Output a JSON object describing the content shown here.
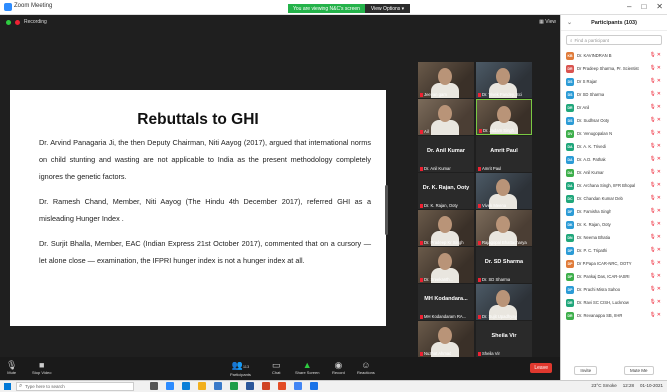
{
  "window": {
    "title": "Zoom Meeting"
  },
  "share_bar": {
    "sharing_label": "You are viewing N&C's screen",
    "view_options": "View Options ▾"
  },
  "meeting": {
    "recording_label": "Recording",
    "view_label": "View"
  },
  "slide": {
    "title": "Rebuttals to GHI",
    "p1": "Dr. Arvind Panagaria Ji, the then Deputy Chairman, Niti Aayog (2017), argued that international norms on child stunting and wasting are not applicable to India as the present methodology completely ignores the genetic factors.",
    "p2": "Dr. Ramesh Chand, Member, Niti Aayog (The Hindu 4th December 2017), referred GHI as a misleading Hunger Index .",
    "p3": "Dr. Surjit Bhalla, Member, EAC (Indian Express 21st October 2017), commented that on a cursory — let alone close — examination, the IFPRI hunger index is not a hunger index at all."
  },
  "video_tiles": [
    {
      "caption": "Jeevan gam",
      "kind": "photo"
    },
    {
      "caption": "Dr. Vivek Pandey, Sci",
      "kind": "photo2"
    },
    {
      "caption": "Ail",
      "kind": "photo3"
    },
    {
      "caption": "Dr. Jadam Singh",
      "kind": "photo",
      "active": true
    },
    {
      "caption": "Dr. Anil Kumar",
      "name_big": "Dr. Anil Kumar",
      "kind": "name"
    },
    {
      "caption": "Amrit Paul",
      "name_big": "Amrit Paul",
      "kind": "name"
    },
    {
      "caption": "Dr. K. Rajan, Ooty",
      "name_big": "Dr. K. Rajan, Ooty",
      "kind": "name"
    },
    {
      "caption": "Vivek Meena",
      "kind": "photo2"
    },
    {
      "caption": "Dr. Pradeep Kr Singh",
      "kind": "photo"
    },
    {
      "caption": "Rajagopal Bhattacharya",
      "kind": "photo3"
    },
    {
      "caption": "Dr. Sreekanth...",
      "kind": "photo"
    },
    {
      "caption": "Dr. SD Sharma",
      "name_big": "Dr. SD Sharma",
      "kind": "name"
    },
    {
      "caption": "MH Kodandaram RA...",
      "name_big": "MH Kodandara...",
      "kind": "name"
    },
    {
      "caption": "Dr. Sujit Upadhyay",
      "kind": "photo2"
    },
    {
      "caption": "Nuzhat Ahmad",
      "kind": "photo"
    },
    {
      "caption": "Sheila Vir",
      "name_big": "Sheila Vir",
      "kind": "name"
    }
  ],
  "toolbar": {
    "mute": "Mute",
    "stop_video": "Stop Video",
    "participants": "Participants",
    "participants_count": "113",
    "chat": "Chat",
    "share_screen": "Share Screen",
    "record": "Record",
    "reactions": "Reactions",
    "leave": "Leave"
  },
  "panel": {
    "title": "Participants (103)",
    "search_placeholder": "Find a participant",
    "invite": "Invite",
    "mute_me": "Mute Me",
    "participants": [
      {
        "initials": "KB",
        "name": "Dr. KAVINDRAN B",
        "color": "#e07b39"
      },
      {
        "initials": "DR",
        "name": "Dr Pradeep Sharma, Pr. Scientist",
        "color": "#d9534f"
      },
      {
        "initials": "DS",
        "name": "Dr S Rajan",
        "color": "#2b9bd6"
      },
      {
        "initials": "DS",
        "name": "Dr SD Sharma",
        "color": "#2b9bd6"
      },
      {
        "initials": "DR",
        "name": "Dr Anil",
        "color": "#1fa67a"
      },
      {
        "initials": "DS",
        "name": "Dr. Sudhsar Ooty",
        "color": "#2b9bd6"
      },
      {
        "initials": "DV",
        "name": "Dr. Venugopalan N",
        "color": "#3cae4a"
      },
      {
        "initials": "DA",
        "name": "Dr. A. K. Trivedi",
        "color": "#1fa67a"
      },
      {
        "initials": "DA",
        "name": "Dr. A.D. Pathak",
        "color": "#2b9bd6"
      },
      {
        "initials": "DA",
        "name": "Dr. Anil Kumar",
        "color": "#3cae4a"
      },
      {
        "initials": "DA",
        "name": "Dr. Archana Singh, IIFR Bhopal",
        "color": "#1fa67a"
      },
      {
        "initials": "DC",
        "name": "Dr. Chandan Kumar Deb",
        "color": "#1fa67a"
      },
      {
        "initials": "DF",
        "name": "Dr. Famisha Singh",
        "color": "#2b9bd6"
      },
      {
        "initials": "DK",
        "name": "Dr. K. Rajan, Ooty",
        "color": "#2b9bd6"
      },
      {
        "initials": "DN",
        "name": "Dr. Neema Bhatia",
        "color": "#1fa67a"
      },
      {
        "initials": "DP",
        "name": "Dr. P. C. Tripathi",
        "color": "#2b9bd6"
      },
      {
        "initials": "DP",
        "name": "Dr P.Papa ICAR-NRC, OOTY",
        "color": "#e07b39"
      },
      {
        "initials": "DP",
        "name": "Dr. Pankaj Das, ICAR-IASRI",
        "color": "#3cae4a"
      },
      {
        "initials": "DP",
        "name": "Dr. Prachi Misra Sahoo",
        "color": "#2b9bd6"
      },
      {
        "initials": "DR",
        "name": "Dr. Ravi SC CISH, Lucknow",
        "color": "#1fa67a"
      },
      {
        "initials": "DR",
        "name": "Dr. Revanappa SB, IIHR",
        "color": "#3cae4a"
      }
    ]
  },
  "taskbar": {
    "search_placeholder": "Type here to search",
    "weather": "23°C Smoke",
    "time": "12:28",
    "date": "01-10-2021"
  }
}
